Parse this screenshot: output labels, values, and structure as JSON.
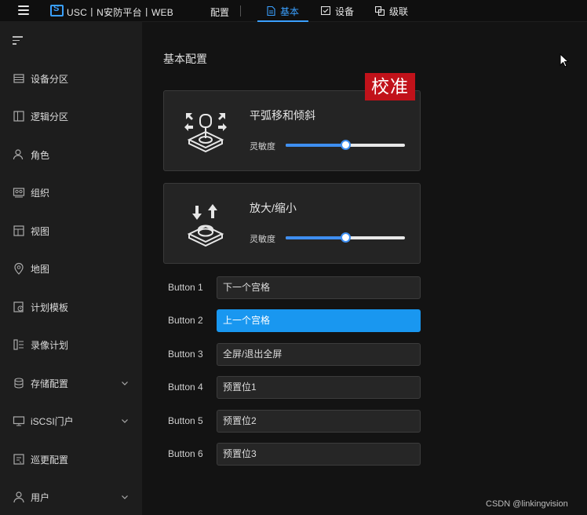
{
  "topbar": {
    "app_title": "USC丨N安防平台丨WEB",
    "config_label": "配置",
    "tabs": [
      {
        "label": "基本",
        "icon": "document-icon",
        "active": true
      },
      {
        "label": "设备",
        "icon": "device-check-icon",
        "active": false
      },
      {
        "label": "级联",
        "icon": "cascade-icon",
        "active": false
      }
    ]
  },
  "sidebar": {
    "items": [
      {
        "label": "设备分区",
        "icon": "device-partition-icon"
      },
      {
        "label": "逻辑分区",
        "icon": "logic-partition-icon"
      },
      {
        "label": "角色",
        "icon": "role-icon"
      },
      {
        "label": "组织",
        "icon": "organization-icon"
      },
      {
        "label": "视图",
        "icon": "view-icon"
      },
      {
        "label": "地图",
        "icon": "map-pin-icon"
      },
      {
        "label": "计划模板",
        "icon": "plan-template-icon"
      },
      {
        "label": "录像计划",
        "icon": "record-plan-icon"
      },
      {
        "label": "存储配置",
        "icon": "storage-icon",
        "expandable": true
      },
      {
        "label": "iSCSI门户",
        "icon": "iscsi-monitor-icon",
        "expandable": true
      },
      {
        "label": "巡更配置",
        "icon": "patrol-icon"
      },
      {
        "label": "用户",
        "icon": "user-icon",
        "expandable": true
      }
    ]
  },
  "main": {
    "section_title": "基本配置",
    "calibration_stamp": "校准",
    "cards": [
      {
        "title": "平弧移和倾斜",
        "sensitivity_label": "灵敏度",
        "sensitivity_fraction": 0.5,
        "icon": "joystick-pan-tilt-icon"
      },
      {
        "title": "放大/缩小",
        "sensitivity_label": "灵敏度",
        "sensitivity_fraction": 0.5,
        "icon": "joystick-zoom-icon"
      }
    ],
    "buttons": [
      {
        "label": "Button 1",
        "value": "下一个宫格",
        "selected": false
      },
      {
        "label": "Button 2",
        "value": "上一个宫格",
        "selected": true
      },
      {
        "label": "Button 3",
        "value": "全屏/退出全屏",
        "selected": false
      },
      {
        "label": "Button 4",
        "value": "预置位1",
        "selected": false
      },
      {
        "label": "Button 5",
        "value": "预置位2",
        "selected": false
      },
      {
        "label": "Button 6",
        "value": "预置位3",
        "selected": false
      }
    ]
  },
  "watermark": "CSDN @linkingvision",
  "colors": {
    "accent": "#3aa0ff",
    "selected_button": "#1997f0",
    "stamp_red": "#c1121a",
    "sidebar_bg": "#1d1d1d",
    "main_bg": "#131313"
  }
}
